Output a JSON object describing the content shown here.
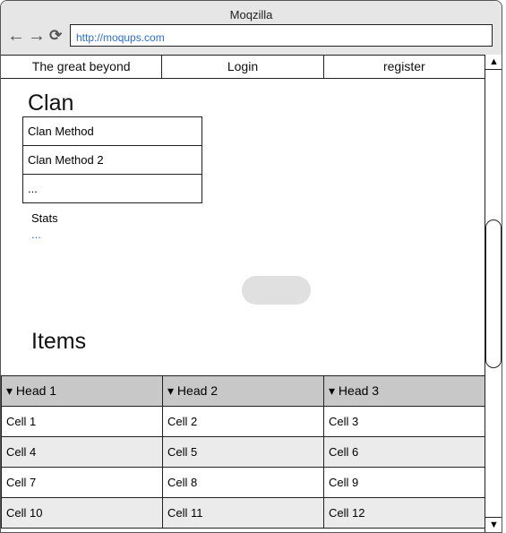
{
  "browser": {
    "title": "Moqzilla",
    "url": "http://moqups.com",
    "icons": [
      "arrow-left-icon",
      "arrow-right-icon",
      "reload-icon"
    ]
  },
  "menu": [
    "The great beyond",
    "Login",
    "register"
  ],
  "clan": {
    "heading": "Clan",
    "methods": [
      "Clan Method",
      "Clan Method 2",
      "..."
    ],
    "stats_label": "Stats",
    "stats_value": "..."
  },
  "items": {
    "heading": "Items",
    "headers": [
      "▾ Head 1",
      "▾ Head 2",
      "▾ Head 3"
    ],
    "rows": [
      [
        "Cell 1",
        "Cell 2",
        "Cell 3"
      ],
      [
        "Cell 4",
        "Cell 5",
        "Cell 6"
      ],
      [
        "Cell 7",
        "Cell 8",
        "Cell 9"
      ],
      [
        "Cell 10",
        "Cell 11",
        "Cell 12"
      ]
    ]
  },
  "colors": {
    "link": "#2a6fdb",
    "header_bg": "#c8c8c8",
    "alt_row": "#ebebeb"
  }
}
